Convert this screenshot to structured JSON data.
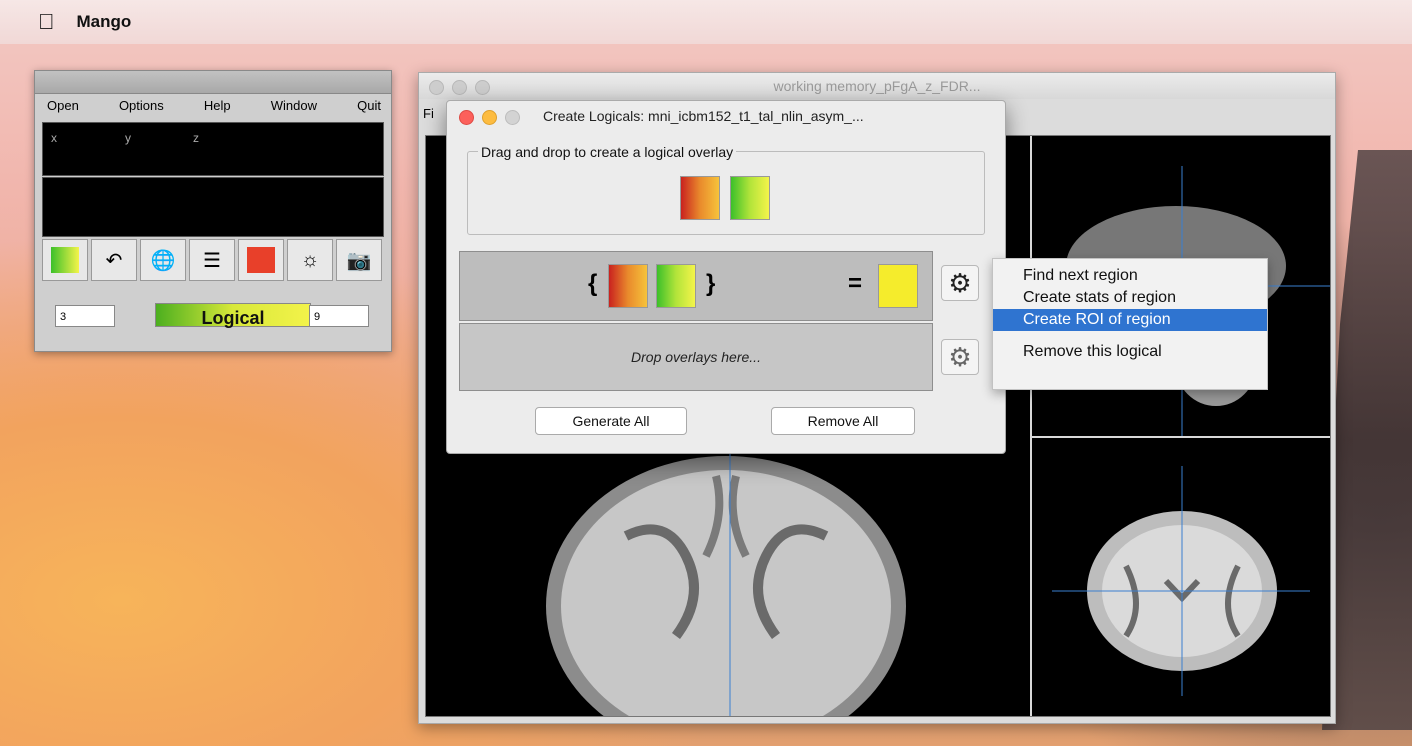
{
  "menubar": {
    "app_name": "Mango"
  },
  "mango_toolbar": {
    "menu": [
      "Open",
      "Options",
      "Help",
      "Window",
      "Quit"
    ],
    "coords": {
      "x": "x",
      "y": "y",
      "z": "z"
    },
    "tools": [
      "overlay-swatch-green",
      "undo-crosshair",
      "globe",
      "layers",
      "color-swatch-red",
      "brightness",
      "camera"
    ],
    "lut": {
      "min": "3",
      "label": "Logical",
      "max": "9"
    }
  },
  "viewer": {
    "title": "working memory_pFgA_z_FDR...",
    "menu_partial": "Fi"
  },
  "dialog": {
    "title": "Create Logicals: mni_icbm152_t1_tal_nlin_asym_...",
    "group_legend": "Drag and drop to create a logical overlay",
    "open_brace": "{",
    "close_brace": "}",
    "equals": "=",
    "drop_placeholder": "Drop overlays here...",
    "generate_all": "Generate All",
    "remove_all": "Remove All"
  },
  "context_menu": {
    "items": [
      "Find next region",
      "Create stats of region",
      "Create ROI of region",
      "Remove this logical"
    ],
    "selected": "Create ROI of region"
  },
  "colors": {
    "crosshair": "#3a7fd0",
    "selection": "#2f74d0",
    "close": "#fc605b",
    "minimize": "#fdbc40"
  }
}
